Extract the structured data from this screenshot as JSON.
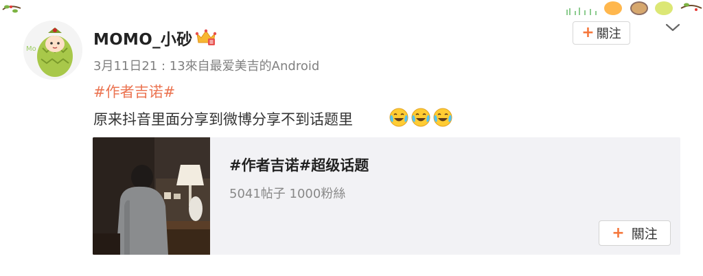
{
  "post": {
    "username": "MOMO_小砂",
    "meta": "3月11日21 : 13來自最爱美吉的Android",
    "hashtag": "#作者吉诺#",
    "text": "原来抖音里面分享到微博分享不到话题里",
    "emojis": [
      "crying-laughing-emoji",
      "crying-laughing-emoji",
      "crying-laughing-emoji"
    ],
    "follow_label": "關注"
  },
  "topic_card": {
    "title": "#作者吉诺#超级话题",
    "stats": "5041帖子 1000粉絲",
    "follow_label": "關注"
  },
  "colors": {
    "accent_orange": "#eb7350",
    "plus_orange": "#f5763a",
    "card_bg": "#f2f2f5"
  }
}
